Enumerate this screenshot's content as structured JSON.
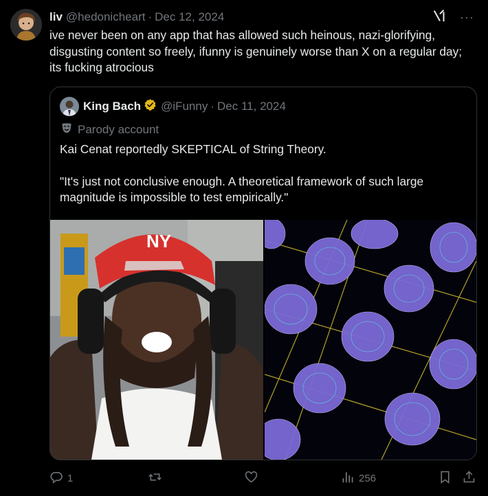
{
  "tweet": {
    "author_name": "liv",
    "author_handle": "@hedonicheart",
    "separator": "·",
    "date": "Dec 12, 2024",
    "text": "ive never been on any app that has allowed such heinous, nazi-glorifying, disgusting content so freely, ifunny is genuinely worse than X on a regular day; its fucking atrocious",
    "more_label": "···"
  },
  "quote": {
    "author_name": "King Bach",
    "author_handle": "@iFunny",
    "separator": "·",
    "date": "Dec 11, 2024",
    "parody_label": "Parody account",
    "text_line1": "Kai Cenat reportedly SKEPTICAL of String Theory.",
    "text_line2": "\"It's just not conclusive enough. A theoretical framework of such large magnitude is impossible to test empirically.\"",
    "verified_color": "#e2b719",
    "images": [
      "photo of streamer wearing red NY cap and headphones",
      "string theory Calabi-Yau manifold render"
    ]
  },
  "actions": {
    "replies": "1",
    "reposts": "",
    "likes": "",
    "views": "256"
  },
  "colors": {
    "background": "#000000",
    "text": "#e7e9ea",
    "secondary": "#71767b",
    "border": "#2f3336"
  },
  "icons": [
    "grok-icon",
    "more-icon",
    "verified-badge-icon",
    "parody-mask-icon",
    "reply-icon",
    "repost-icon",
    "like-icon",
    "views-icon",
    "bookmark-icon",
    "share-icon"
  ]
}
